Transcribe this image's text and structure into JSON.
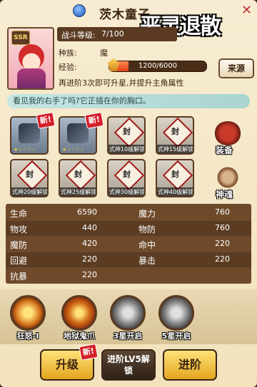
{
  "header": {
    "title": "茨木童子",
    "banner": "恶灵退散"
  },
  "portrait": {
    "rank": "SSR"
  },
  "info": {
    "level_label": "战斗等级:",
    "level_value": "7/100",
    "race_label": "种族:",
    "race_value": "魔",
    "exp_label": "经验:",
    "exp_current": 1200,
    "exp_max": 6000,
    "exp_text": "1200/6000",
    "exp_fraction": 0.2,
    "promote_text": "再进阶3次即可升星,并提升主角属性",
    "source_button": "来源"
  },
  "quote": "看见我的右手了吗?它正插在你的胸口。",
  "equipment": {
    "new_tag": "新!",
    "slots": [
      {
        "type": "owned"
      },
      {
        "type": "owned"
      },
      {
        "type": "locked",
        "seal": "封",
        "caption": "式神10级解锁"
      },
      {
        "type": "locked",
        "seal": "封",
        "caption": "式神15级解锁"
      },
      {
        "type": "locked",
        "seal": "封",
        "caption": "式神20级解锁"
      },
      {
        "type": "locked",
        "seal": "封",
        "caption": "式神25级解锁"
      },
      {
        "type": "locked",
        "seal": "封",
        "caption": "式神30级解锁"
      },
      {
        "type": "locked",
        "seal": "封",
        "caption": "式神40级解锁"
      }
    ],
    "equip_label": "装备",
    "soul_label": "神魂"
  },
  "stats": {
    "rows": [
      {
        "l1": "生命",
        "v1": "6590",
        "l2": "魔力",
        "v2": "760"
      },
      {
        "l1": "物攻",
        "v1": "440",
        "l2": "物防",
        "v2": "760"
      },
      {
        "l1": "魔防",
        "v1": "420",
        "l2": "命中",
        "v2": "220"
      },
      {
        "l1": "回避",
        "v1": "220",
        "l2": "暴击",
        "v2": "220"
      },
      {
        "l1": "抗暴",
        "v1": "220",
        "l2": "",
        "v2": ""
      }
    ]
  },
  "skills": [
    {
      "label": "狂怒-I"
    },
    {
      "label": "地狱鬼爪"
    },
    {
      "label": "3星开启"
    },
    {
      "label": "5星开启"
    }
  ],
  "buttons": {
    "upgrade": "升级",
    "new_tag": "新!",
    "unlock_line1": "进阶LV5解",
    "unlock_line2": "锁",
    "advance": "进阶"
  },
  "colors": {
    "accent_gold": "#e3a51e",
    "exp_fill": "#e0401b",
    "quote_bg": "#a9d4cf",
    "stats_bg": "#6e4a2b",
    "seal_border": "#a21a1a"
  }
}
